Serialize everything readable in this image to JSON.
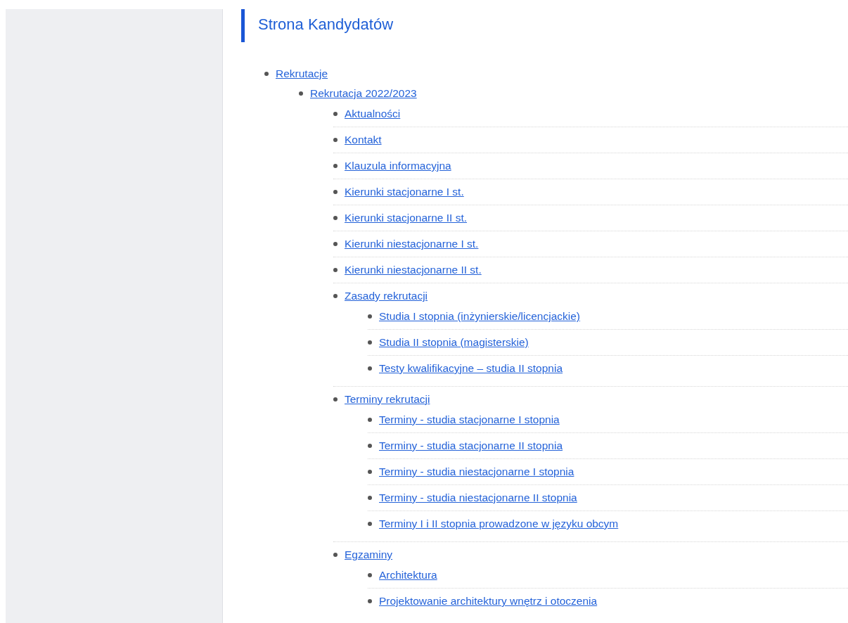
{
  "page_title": "Strona Kandydatów",
  "tree": [
    {
      "label": "Rekrutacje",
      "children": [
        {
          "label": "Rekrutacja 2022/2023",
          "children": [
            {
              "label": "Aktualności"
            },
            {
              "label": "Kontakt"
            },
            {
              "label": "Klauzula informacyjna"
            },
            {
              "label": "Kierunki stacjonarne I st."
            },
            {
              "label": "Kierunki stacjonarne II st."
            },
            {
              "label": "Kierunki niestacjonarne I st."
            },
            {
              "label": "Kierunki niestacjonarne II st."
            },
            {
              "label": "Zasady rekrutacji",
              "children": [
                {
                  "label": "Studia I stopnia (inżynierskie/licencjackie)"
                },
                {
                  "label": "Studia II stopnia (magisterskie)"
                },
                {
                  "label": "Testy kwalifikacyjne – studia II stopnia"
                }
              ]
            },
            {
              "label": "Terminy rekrutacji",
              "children": [
                {
                  "label": "Terminy - studia stacjonarne I stopnia"
                },
                {
                  "label": "Terminy - studia stacjonarne II stopnia"
                },
                {
                  "label": "Terminy - studia niestacjonarne I stopnia"
                },
                {
                  "label": "Terminy - studia niestacjonarne II stopnia"
                },
                {
                  "label": "Terminy I i II stopnia prowadzone w języku obcym"
                }
              ]
            },
            {
              "label": "Egzaminy",
              "children": [
                {
                  "label": "Architektura"
                },
                {
                  "label": "Projektowanie architektury wnętrz i otoczenia"
                }
              ]
            }
          ]
        }
      ]
    }
  ]
}
